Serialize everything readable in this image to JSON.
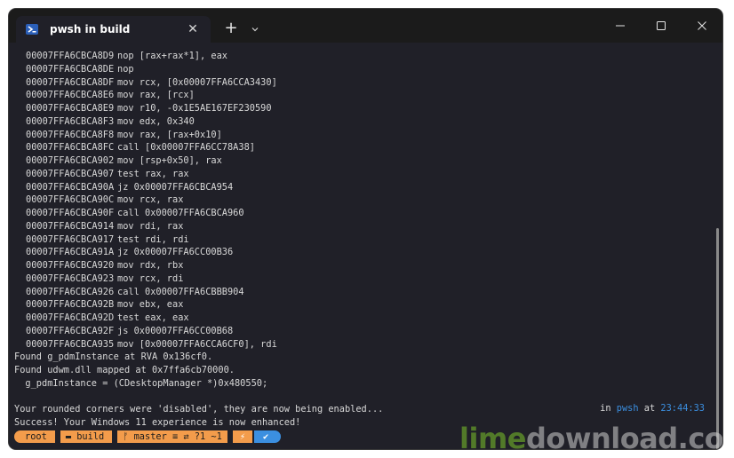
{
  "window": {
    "tab_title": "pwsh in build",
    "tab_icon": "powershell-icon",
    "new_tab_symbol": "+",
    "close_symbol": "✕"
  },
  "terminal": {
    "asm": [
      {
        "addr": "00007FFA6CBCA8D9",
        "instr": "nop [rax+rax*1], eax"
      },
      {
        "addr": "00007FFA6CBCA8DE",
        "instr": "nop"
      },
      {
        "addr": "00007FFA6CBCA8DF",
        "instr": "mov rcx, [0x00007FFA6CCA3430]"
      },
      {
        "addr": "00007FFA6CBCA8E6",
        "instr": "mov rax, [rcx]"
      },
      {
        "addr": "00007FFA6CBCA8E9",
        "instr": "mov r10, -0x1E5AE167EF230590"
      },
      {
        "addr": "00007FFA6CBCA8F3",
        "instr": "mov edx, 0x340"
      },
      {
        "addr": "00007FFA6CBCA8F8",
        "instr": "mov rax, [rax+0x10]"
      },
      {
        "addr": "00007FFA6CBCA8FC",
        "instr": "call [0x00007FFA6CC78A38]"
      },
      {
        "addr": "00007FFA6CBCA902",
        "instr": "mov [rsp+0x50], rax"
      },
      {
        "addr": "00007FFA6CBCA907",
        "instr": "test rax, rax"
      },
      {
        "addr": "00007FFA6CBCA90A",
        "instr": "jz 0x00007FFA6CBCA954"
      },
      {
        "addr": "00007FFA6CBCA90C",
        "instr": "mov rcx, rax"
      },
      {
        "addr": "00007FFA6CBCA90F",
        "instr": "call 0x00007FFA6CBCA960"
      },
      {
        "addr": "00007FFA6CBCA914",
        "instr": "mov rdi, rax"
      },
      {
        "addr": "00007FFA6CBCA917",
        "instr": "test rdi, rdi"
      },
      {
        "addr": "00007FFA6CBCA91A",
        "instr": "jz 0x00007FFA6CC00B36"
      },
      {
        "addr": "00007FFA6CBCA920",
        "instr": "mov rdx, rbx"
      },
      {
        "addr": "00007FFA6CBCA923",
        "instr": "mov rcx, rdi"
      },
      {
        "addr": "00007FFA6CBCA926",
        "instr": "call 0x00007FFA6CBBB904"
      },
      {
        "addr": "00007FFA6CBCA92B",
        "instr": "mov ebx, eax"
      },
      {
        "addr": "00007FFA6CBCA92D",
        "instr": "test eax, eax"
      },
      {
        "addr": "00007FFA6CBCA92F",
        "instr": "js 0x00007FFA6CC00B68"
      },
      {
        "addr": "00007FFA6CBCA935",
        "instr": "mov [0x00007FFA6CCA6CF0], rdi"
      }
    ],
    "messages": [
      "Found g_pdmInstance at RVA 0x136cf0.",
      "Found udwm.dll mapped at 0x7ffa6cb70000.",
      "  g_pdmInstance = (CDesktopManager *)0x480550;",
      "",
      "Your rounded corners were 'disabled', they are now being enabled...",
      "Success! Your Windows 11 experience is now enhanced!"
    ],
    "prompt": {
      "user": "root",
      "folder": "build",
      "git": "master ≡ ⇄ ?1 ~1",
      "bolt": "⚡",
      "status": "✔"
    },
    "right_prompt": {
      "in_label": "in",
      "shell": "pwsh",
      "at_label": "at",
      "time": "23:44:33"
    }
  },
  "watermark": {
    "part1": "lime",
    "part2": "download.com"
  }
}
